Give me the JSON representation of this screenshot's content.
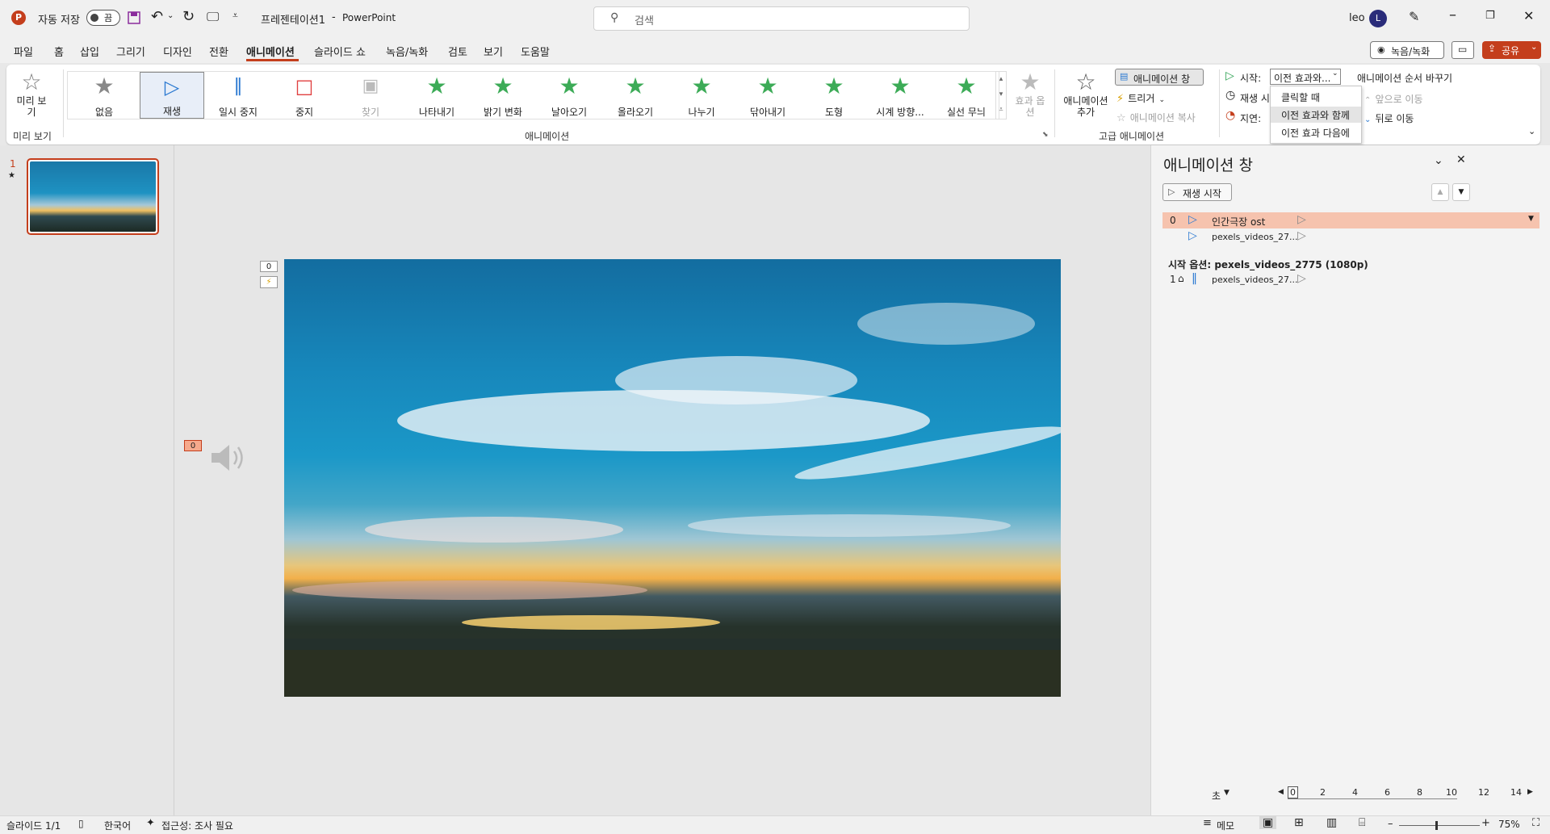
{
  "titlebar": {
    "autosave_label": "자동 저장",
    "autosave_state": "끔",
    "doc_title": "프레젠테이션1",
    "separator": "-",
    "app_name": "PowerPoint",
    "search_placeholder": "검색",
    "user_name": "leo",
    "avatar_letter": "L"
  },
  "menu": {
    "tabs": [
      "파일",
      "홈",
      "삽입",
      "그리기",
      "디자인",
      "전환",
      "애니메이션",
      "슬라이드 쇼",
      "녹음/녹화",
      "검토",
      "보기",
      "도움말"
    ],
    "active_tab": "애니메이션",
    "record_label": "녹음/녹화",
    "share_label": "공유"
  },
  "ribbon": {
    "preview_label": "미리 보기",
    "preview_group": "미리 보기",
    "gallery": [
      "없음",
      "재생",
      "일시 중지",
      "중지",
      "찾기",
      "나타내기",
      "밝기 변화",
      "날아오기",
      "올라오기",
      "나누기",
      "닦아내기",
      "도형",
      "시계 방향...",
      "실선 무늬"
    ],
    "effect_options": "효과 옵션",
    "animation_group": "애니메이션",
    "add_animation": "애니메이션 추가",
    "anim_pane_btn": "애니메이션 창",
    "trigger": "트리거",
    "anim_copy": "애니메이션 복사",
    "advanced_group": "고급 애니메이션",
    "start_label": "시작:",
    "start_value": "이전 효과와...",
    "duration_label": "재생 시",
    "delay_label": "지연:",
    "reorder_label": "애니메이션 순서 바꾸기",
    "move_earlier": "앞으로 이동",
    "move_later": "뒤로 이동",
    "dropdown_options": [
      "클릭할 때",
      "이전 효과와 함께",
      "이전 효과 다음에"
    ],
    "dropdown_selected": "이전 효과와 함께"
  },
  "thumbs": {
    "slide_number": "1",
    "slide_marker": "★"
  },
  "slide": {
    "tag_top": "0",
    "tag_audio": "0"
  },
  "anim_pane": {
    "title": "애니메이션 창",
    "play_button": "재생 시작",
    "items": [
      {
        "num": "0",
        "name": "인간극장 ost"
      },
      {
        "num": "",
        "name": "pexels_videos_27..."
      }
    ],
    "trigger_heading": "시작 옵션: pexels_videos_2775 (1080p)",
    "trigger_item": {
      "num": "1",
      "name": "pexels_videos_27..."
    },
    "seconds_label": "초",
    "timeline_ticks": [
      "0",
      "2",
      "4",
      "6",
      "8",
      "10",
      "12",
      "14"
    ]
  },
  "status": {
    "slide_info": "슬라이드 1/1",
    "language": "한국어",
    "accessibility": "접근성: 조사 필요",
    "notes": "메모",
    "zoom": "75%"
  },
  "colors": {
    "accent": "#c43e1c",
    "anim_blue": "#2b79d1",
    "selected_row": "#f6c3ae",
    "green_star": "#3cab57"
  }
}
